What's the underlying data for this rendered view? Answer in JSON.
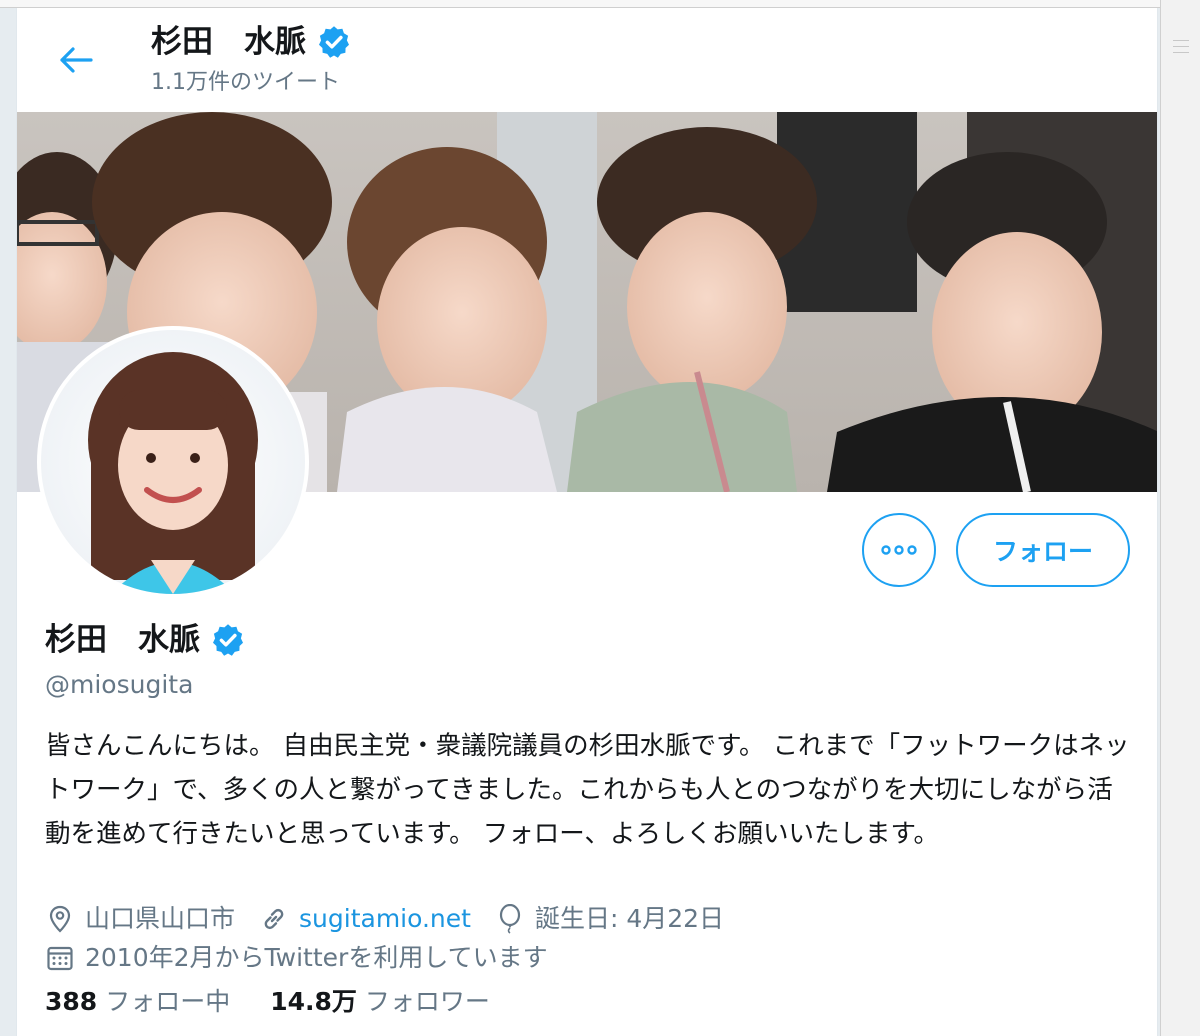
{
  "header": {
    "title": "杉田　水脈",
    "tweet_count": "1.1万件のツイート"
  },
  "profile": {
    "name": "杉田　水脈",
    "handle": "@miosugita",
    "bio": "皆さんこんにちは。 自由民主党・衆議院議員の杉田水脈です。 これまで「フットワークはネットワーク」で、多くの人と繋がってきました。これからも人とのつながりを大切にしながら活動を進めて行きたいと思っています。 フォロー、よろしくお願いいたします。",
    "location": "山口県山口市",
    "website": "sugitamio.net",
    "birthday": "誕生日: 4月22日",
    "joined": "2010年2月からTwitterを利用しています"
  },
  "actions": {
    "follow_label": "フォロー"
  },
  "stats": {
    "following_count": "388",
    "following_label": "フォロー中",
    "followers_count": "14.8万",
    "followers_label": "フォロワー"
  },
  "colors": {
    "accent": "#1da1f2",
    "link": "#1b95e0",
    "muted": "#657786",
    "text": "#14171a"
  },
  "icons": {
    "back": "arrow-left-icon",
    "verified": "verified-badge-icon",
    "more": "more-dots-icon",
    "location": "location-pin-icon",
    "link": "link-icon",
    "birthday": "balloon-icon",
    "calendar": "calendar-icon"
  }
}
